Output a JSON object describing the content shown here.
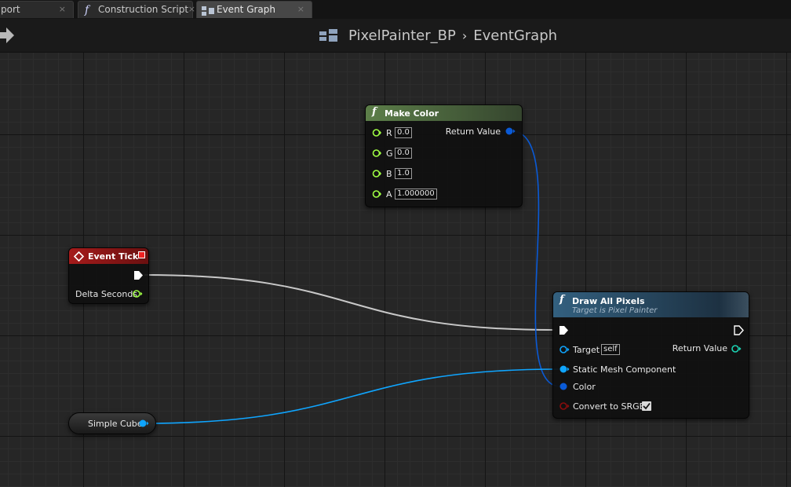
{
  "tabs": [
    {
      "label": "port",
      "close": "×"
    },
    {
      "label": "Construction Script",
      "close": "×",
      "icon": "function-icon"
    },
    {
      "label": "Event Graph",
      "close": "×",
      "icon": "graph-icon",
      "active": true
    }
  ],
  "breadcrumb": {
    "blueprint": "PixelPainter_BP",
    "separator": "›",
    "graph": "EventGraph"
  },
  "colors": {
    "exec_wire": "#c8c8c8",
    "object_pin": "#0fa5ff",
    "struct_pin": "#0a5ad6",
    "float_pin": "#9fff44",
    "bool_pin": "#7a0000",
    "event_header": "#8a1515",
    "pure_fn_header": "#4b6a3b",
    "fn_header": "#2a4a63"
  },
  "nodes": {
    "make_color": {
      "title": "Make Color",
      "inputs": [
        {
          "name": "R",
          "value": "0.0"
        },
        {
          "name": "G",
          "value": "0.0"
        },
        {
          "name": "B",
          "value": "1.0"
        },
        {
          "name": "A",
          "value": "1.000000"
        }
      ],
      "output": "Return Value"
    },
    "event_tick": {
      "title": "Event Tick",
      "output": "Delta Seconds"
    },
    "draw_all_pixels": {
      "title": "Draw All Pixels",
      "subtitle": "Target is Pixel Painter",
      "target_label": "Target",
      "target_value": "self",
      "static_mesh_label": "Static Mesh Component",
      "color_label": "Color",
      "convert_label": "Convert to SRGB",
      "convert_checked": true,
      "return_label": "Return Value"
    },
    "simple_cube": {
      "label": "Simple Cube"
    }
  }
}
